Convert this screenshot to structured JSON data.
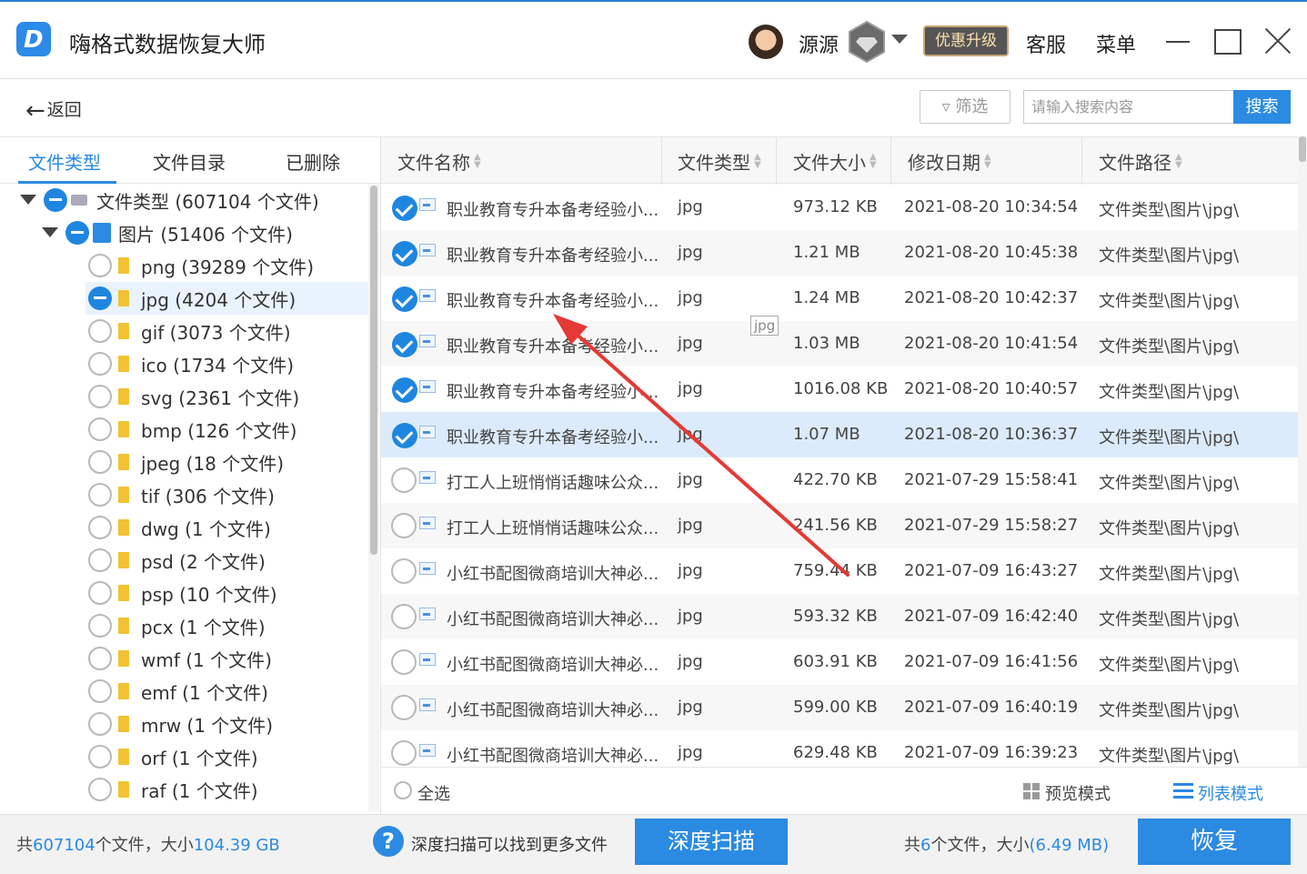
{
  "app": {
    "title": "嗨格式数据恢复大师",
    "accent": "#2b8ae2"
  },
  "header": {
    "username": "源源",
    "upgrade_label": "优惠升级",
    "service_label": "客服",
    "menu_label": "菜单"
  },
  "toolbar": {
    "back_label": "返回",
    "filter_label": "筛选",
    "search_placeholder": "请输入搜索内容",
    "search_button": "搜索"
  },
  "left_tabs": [
    "文件类型",
    "文件目录",
    "已删除"
  ],
  "tree": {
    "root": "文件类型 (607104 个文件)",
    "images": "图片 (51406 个文件)",
    "formats": [
      "png (39289 个文件)",
      "jpg (4204 个文件)",
      "gif (3073 个文件)",
      "ico (1734 个文件)",
      "svg (2361 个文件)",
      "bmp (126 个文件)",
      "jpeg (18 个文件)",
      "tif (306 个文件)",
      "dwg (1 个文件)",
      "psd (2 个文件)",
      "psp (10 个文件)",
      "pcx (1 个文件)",
      "wmf (1 个文件)",
      "emf (1 个文件)",
      "mrw (1 个文件)",
      "orf (1 个文件)",
      "raf (1 个文件)"
    ],
    "selected_format": "jpg"
  },
  "table": {
    "columns": [
      "文件名称",
      "文件类型",
      "文件大小",
      "修改日期",
      "文件路径"
    ],
    "rows": [
      {
        "checked": true,
        "name": "职业教育专升本备考经验小...",
        "type": "jpg",
        "size": "973.12 KB",
        "date": "2021-08-20 10:34:54",
        "path": "文件类型\\图片\\jpg\\"
      },
      {
        "checked": true,
        "name": "职业教育专升本备考经验小...",
        "type": "jpg",
        "size": "1.21 MB",
        "date": "2021-08-20 10:45:38",
        "path": "文件类型\\图片\\jpg\\"
      },
      {
        "checked": true,
        "name": "职业教育专升本备考经验小...",
        "type": "jpg",
        "size": "1.24 MB",
        "date": "2021-08-20 10:42:37",
        "path": "文件类型\\图片\\jpg\\"
      },
      {
        "checked": true,
        "name": "职业教育专升本备考经验小...",
        "type": "jpg",
        "size": "1.03 MB",
        "date": "2021-08-20 10:41:54",
        "path": "文件类型\\图片\\jpg\\"
      },
      {
        "checked": true,
        "name": "职业教育专升本备考经验小...",
        "type": "jpg",
        "size": "1016.08 KB",
        "date": "2021-08-20 10:40:57",
        "path": "文件类型\\图片\\jpg\\"
      },
      {
        "checked": true,
        "name": "职业教育专升本备考经验小...",
        "type": "jpg",
        "size": "1.07 MB",
        "date": "2021-08-20 10:36:37",
        "path": "文件类型\\图片\\jpg\\"
      },
      {
        "checked": false,
        "name": "打工人上班悄悄话趣味公众...",
        "type": "jpg",
        "size": "422.70 KB",
        "date": "2021-07-29 15:58:41",
        "path": "文件类型\\图片\\jpg\\"
      },
      {
        "checked": false,
        "name": "打工人上班悄悄话趣味公众...",
        "type": "jpg",
        "size": "241.56 KB",
        "date": "2021-07-29 15:58:27",
        "path": "文件类型\\图片\\jpg\\"
      },
      {
        "checked": false,
        "name": "小红书配图微商培训大神必...",
        "type": "jpg",
        "size": "759.44 KB",
        "date": "2021-07-09 16:43:27",
        "path": "文件类型\\图片\\jpg\\"
      },
      {
        "checked": false,
        "name": "小红书配图微商培训大神必...",
        "type": "jpg",
        "size": "593.32 KB",
        "date": "2021-07-09 16:42:40",
        "path": "文件类型\\图片\\jpg\\"
      },
      {
        "checked": false,
        "name": "小红书配图微商培训大神必...",
        "type": "jpg",
        "size": "603.91 KB",
        "date": "2021-07-09 16:41:56",
        "path": "文件类型\\图片\\jpg\\"
      },
      {
        "checked": false,
        "name": "小红书配图微商培训大神必...",
        "type": "jpg",
        "size": "599.00 KB",
        "date": "2021-07-09 16:40:19",
        "path": "文件类型\\图片\\jpg\\"
      },
      {
        "checked": false,
        "name": "小红书配图微商培训大神必...",
        "type": "jpg",
        "size": "629.48 KB",
        "date": "2021-07-09 16:39:23",
        "path": "文件类型\\图片\\jpg\\"
      }
    ],
    "selected_row": 6,
    "tooltip": "jpg"
  },
  "table_footer": {
    "select_all": "全选",
    "preview_mode": "预览模式",
    "list_mode": "列表模式"
  },
  "status": {
    "total_prefix": "共",
    "total_count": "607104",
    "total_mid": "个文件，大小",
    "total_size": "104.39 GB",
    "deep_tip": "深度扫描可以找到更多文件",
    "deep_button": "深度扫描",
    "sel_prefix": "共",
    "sel_count": "6",
    "sel_mid": "个文件，大小",
    "sel_size": "(6.49 MB)",
    "recover_button": "恢复"
  },
  "annotation": {
    "color": "#e53935"
  }
}
